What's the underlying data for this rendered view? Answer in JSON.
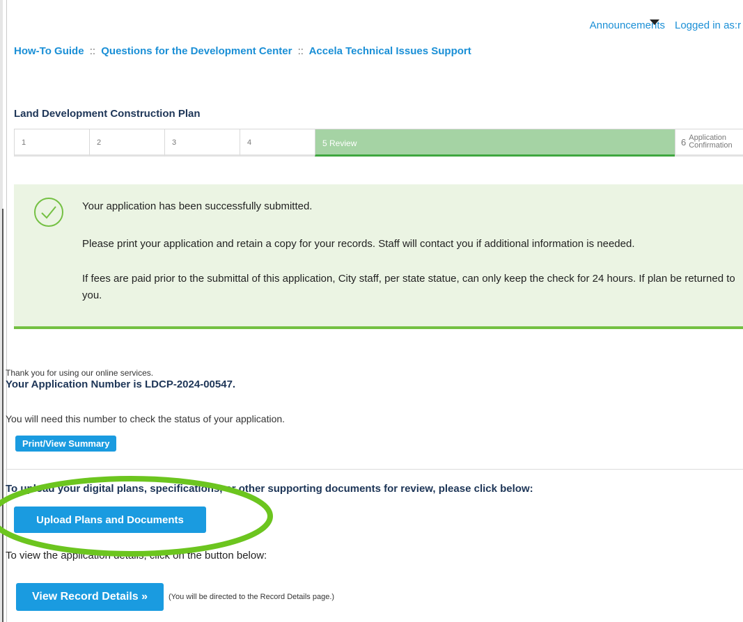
{
  "header": {
    "announcements": "Announcements",
    "logged_in": "Logged in as:r"
  },
  "links": {
    "how_to": "How-To Guide",
    "sep": "::",
    "questions": "Questions for the Development Center",
    "support": "Accela Technical Issues Support"
  },
  "page": {
    "title": "Land Development Construction Plan"
  },
  "steps": [
    {
      "label": "1"
    },
    {
      "label": "2"
    },
    {
      "label": "3"
    },
    {
      "label": "4"
    },
    {
      "label": "5 Review"
    },
    {
      "num": "6",
      "label_line1": "Application",
      "label_line2": "Confirmation"
    }
  ],
  "notice": {
    "line1": "Your application has been successfully submitted.",
    "line2": "Please print your application and retain a copy for your records. Staff will contact you if additional information is needed.",
    "line3": "If fees are paid prior to the submittal of this application, City staff, per state statue, can only keep the check for 24 hours. If plan be returned to you.",
    "accent_color": "#74c043"
  },
  "confirmation": {
    "thanks": "Thank you for using our online services.",
    "app_number": "Your Application Number is LDCP-2024-00547.",
    "need_number": "You will need this number to check the status of your application.",
    "print_button": "Print/View Summary",
    "upload_text": "To upload your digital plans, specifications, or other supporting documents for review, please click below:",
    "upload_button": "Upload Plans and Documents",
    "view_text": "To view the application details, click on the button below:",
    "record_button": "View Record Details »",
    "redirect_note": "(You will be directed to the Record Details page.)"
  },
  "icons": {
    "success": "check-circle-icon",
    "dropdown": "caret-down-icon"
  },
  "colors": {
    "link": "#1a8fd6",
    "button": "#1a9be0",
    "active_step": "#a5d3a4",
    "highlight": "#6cc51f"
  }
}
